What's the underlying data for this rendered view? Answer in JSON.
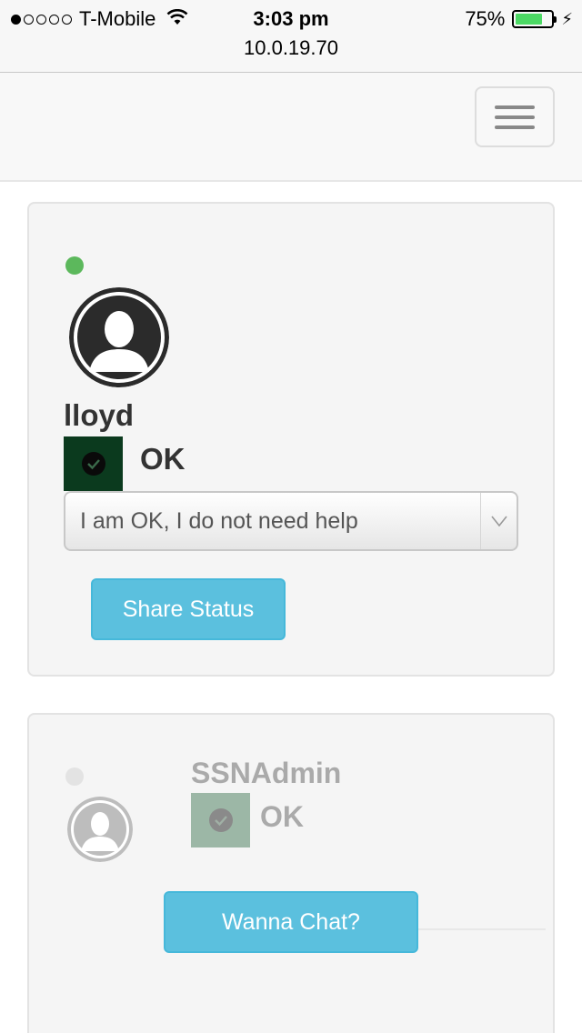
{
  "status_bar": {
    "carrier": "T-Mobile",
    "time": "3:03 pm",
    "battery": "75%",
    "battery_level": 0.75,
    "url": "10.0.19.70"
  },
  "navbar": {
    "menu_icon": "hamburger-menu-icon"
  },
  "users": [
    {
      "username": "lloyd",
      "online": true,
      "status": "OK",
      "status_select": {
        "selected": "I am OK, I do not need help"
      },
      "button_label": "Share Status"
    },
    {
      "username": "SSNAdmin",
      "online": false,
      "status": "OK",
      "button_label": "Wanna Chat?"
    }
  ],
  "colors": {
    "online": "#5cb85c",
    "button": "#5bc0de",
    "battery": "#4cd964"
  }
}
